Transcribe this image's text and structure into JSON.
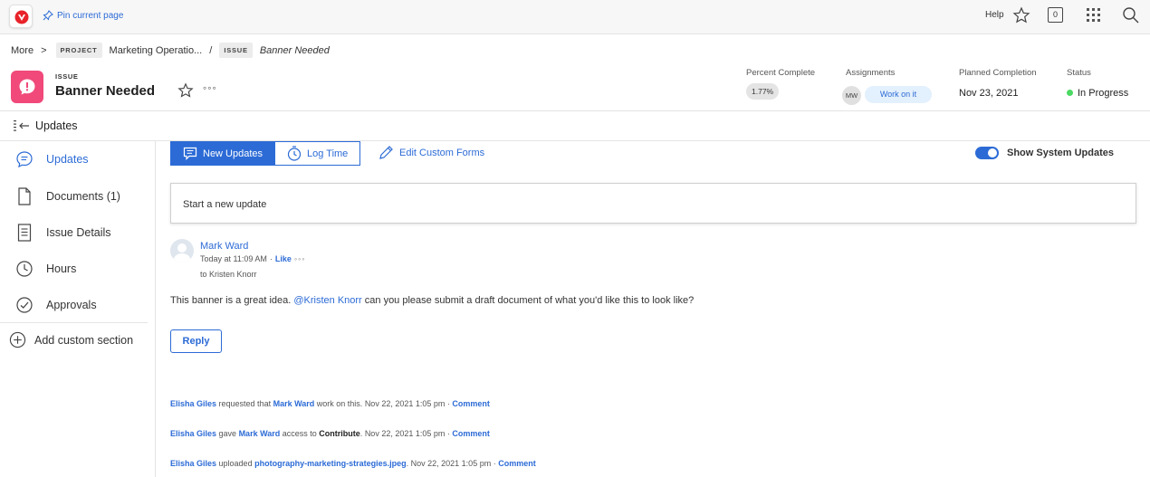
{
  "topbar": {
    "pin_label": "Pin current page",
    "help_label": "Help",
    "notification_count": "0"
  },
  "breadcrumb": {
    "more_label": "More",
    "separator_1": ">",
    "project_tag": "PROJECT",
    "project_name": "Marketing Operatio...",
    "separator_2": "/",
    "issue_tag": "ISSUE",
    "current": "Banner Needed"
  },
  "header": {
    "object_type": "ISSUE",
    "title": "Banner Needed",
    "more_label": "◦◦◦",
    "accent_color": "#f0497a"
  },
  "summary": {
    "percent_label": "Percent Complete",
    "percent_value": "1.77%",
    "assignments_label": "Assignments",
    "assignee_initials": "MW",
    "work_on_it_label": "Work on it",
    "planned_label": "Planned Completion",
    "planned_value": "Nov 23, 2021",
    "status_label": "Status",
    "status_value": "In Progress",
    "status_color": "#4cd964"
  },
  "section": {
    "title": "Updates"
  },
  "nav": {
    "items": [
      {
        "label": "Updates",
        "icon": "chat-bubble-icon"
      },
      {
        "label": "Documents (1)",
        "icon": "document-icon"
      },
      {
        "label": "Issue Details",
        "icon": "details-icon"
      },
      {
        "label": "Hours",
        "icon": "clock-icon"
      },
      {
        "label": "Approvals",
        "icon": "check-circle-icon"
      }
    ],
    "add_section_label": "Add custom section"
  },
  "tabs": {
    "new_updates": "New Updates",
    "log_time": "Log Time",
    "edit_custom_forms": "Edit Custom Forms"
  },
  "toggle": {
    "label": "Show System Updates",
    "on": true
  },
  "composer": {
    "placeholder": "Start a new update"
  },
  "update": {
    "author": "Mark Ward",
    "time": "Today at 11:09 AM",
    "dot": "·",
    "like_label": "Like",
    "more_label": "◦◦◦",
    "to_line": "to Kristen Knorr",
    "message_before": "This banner is a great idea. ",
    "mention": "@Kristen Knorr",
    "message_after": " can you please submit a draft document of what you'd like this to look like?",
    "reply_label": "Reply"
  },
  "system_updates": [
    {
      "who": "Elisha Giles",
      "text1": " requested that ",
      "target": "Mark Ward",
      "text2": " work on this.",
      "date": "Nov 22, 2021 1:05 pm",
      "dot": "·",
      "comment": "Comment"
    },
    {
      "who": "Elisha Giles",
      "text1": " gave ",
      "target": "Mark Ward",
      "text2": " access to ",
      "extra": "Contribute",
      "text3": ".",
      "date": "Nov 22, 2021 1:05 pm",
      "dot": "·",
      "comment": "Comment"
    },
    {
      "who": "Elisha Giles",
      "text1": " uploaded ",
      "target": "photography-marketing-strategies.jpeg",
      "text2": ".",
      "date": "Nov 22, 2021 1:05 pm",
      "dot": "·",
      "comment": "Comment"
    }
  ]
}
